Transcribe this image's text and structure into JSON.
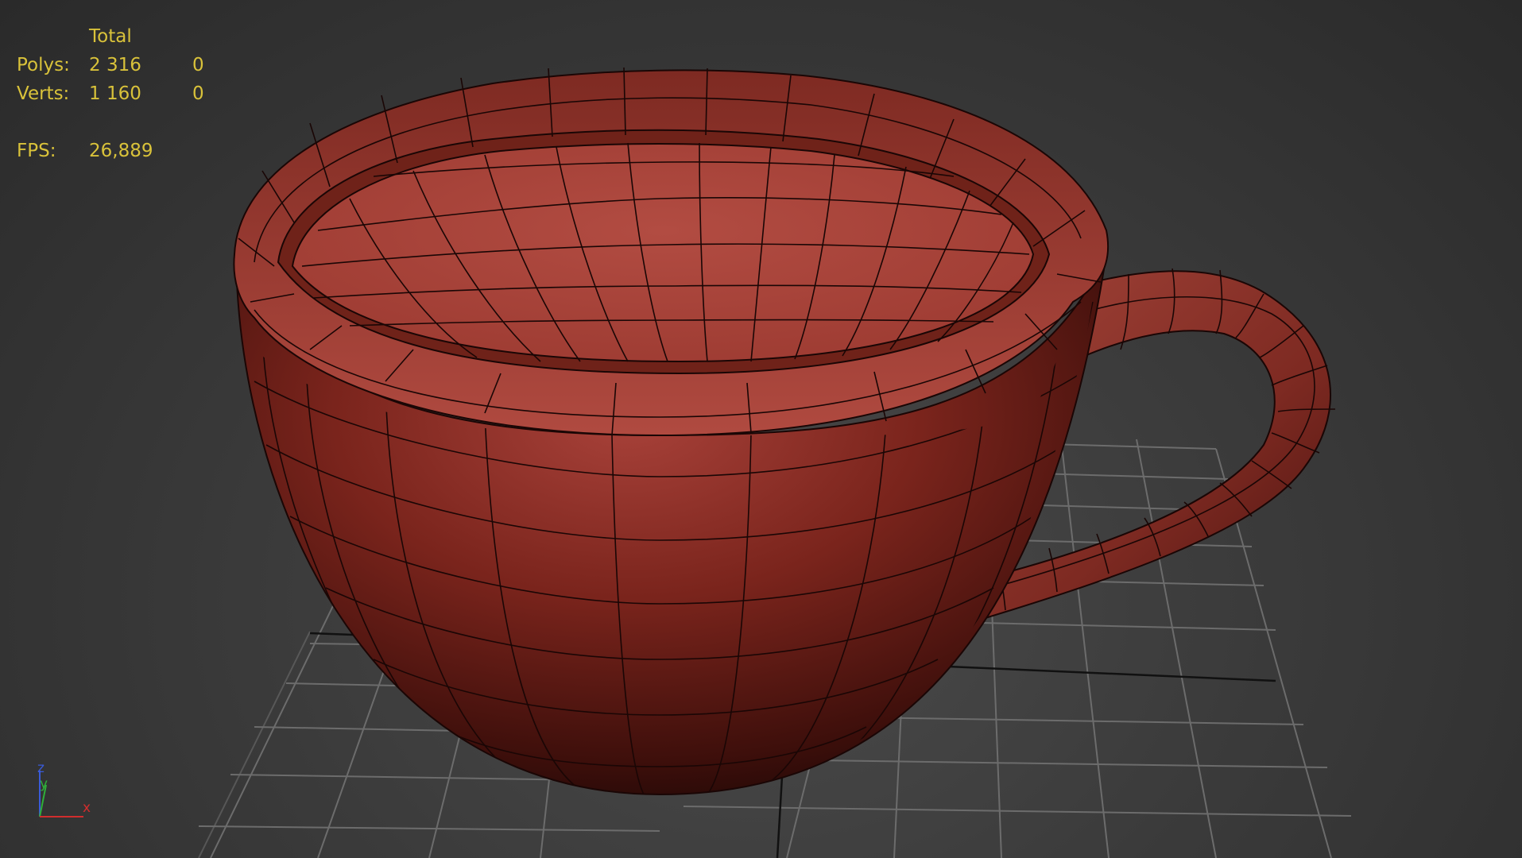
{
  "stats": {
    "header": "Total",
    "rows": [
      {
        "label": "Polys:",
        "total": "2 316",
        "selected": "0"
      },
      {
        "label": "Verts:",
        "total": "1 160",
        "selected": "0"
      }
    ],
    "fps_label": "FPS:",
    "fps_value": "26,889",
    "text_color": "#d9c23a"
  },
  "viewport": {
    "object": "teacup-mesh",
    "mesh_color": "#8a2b22",
    "grid_color": "#6e6e6e",
    "axis": {
      "z": "z",
      "y": "y",
      "x": "x"
    }
  }
}
